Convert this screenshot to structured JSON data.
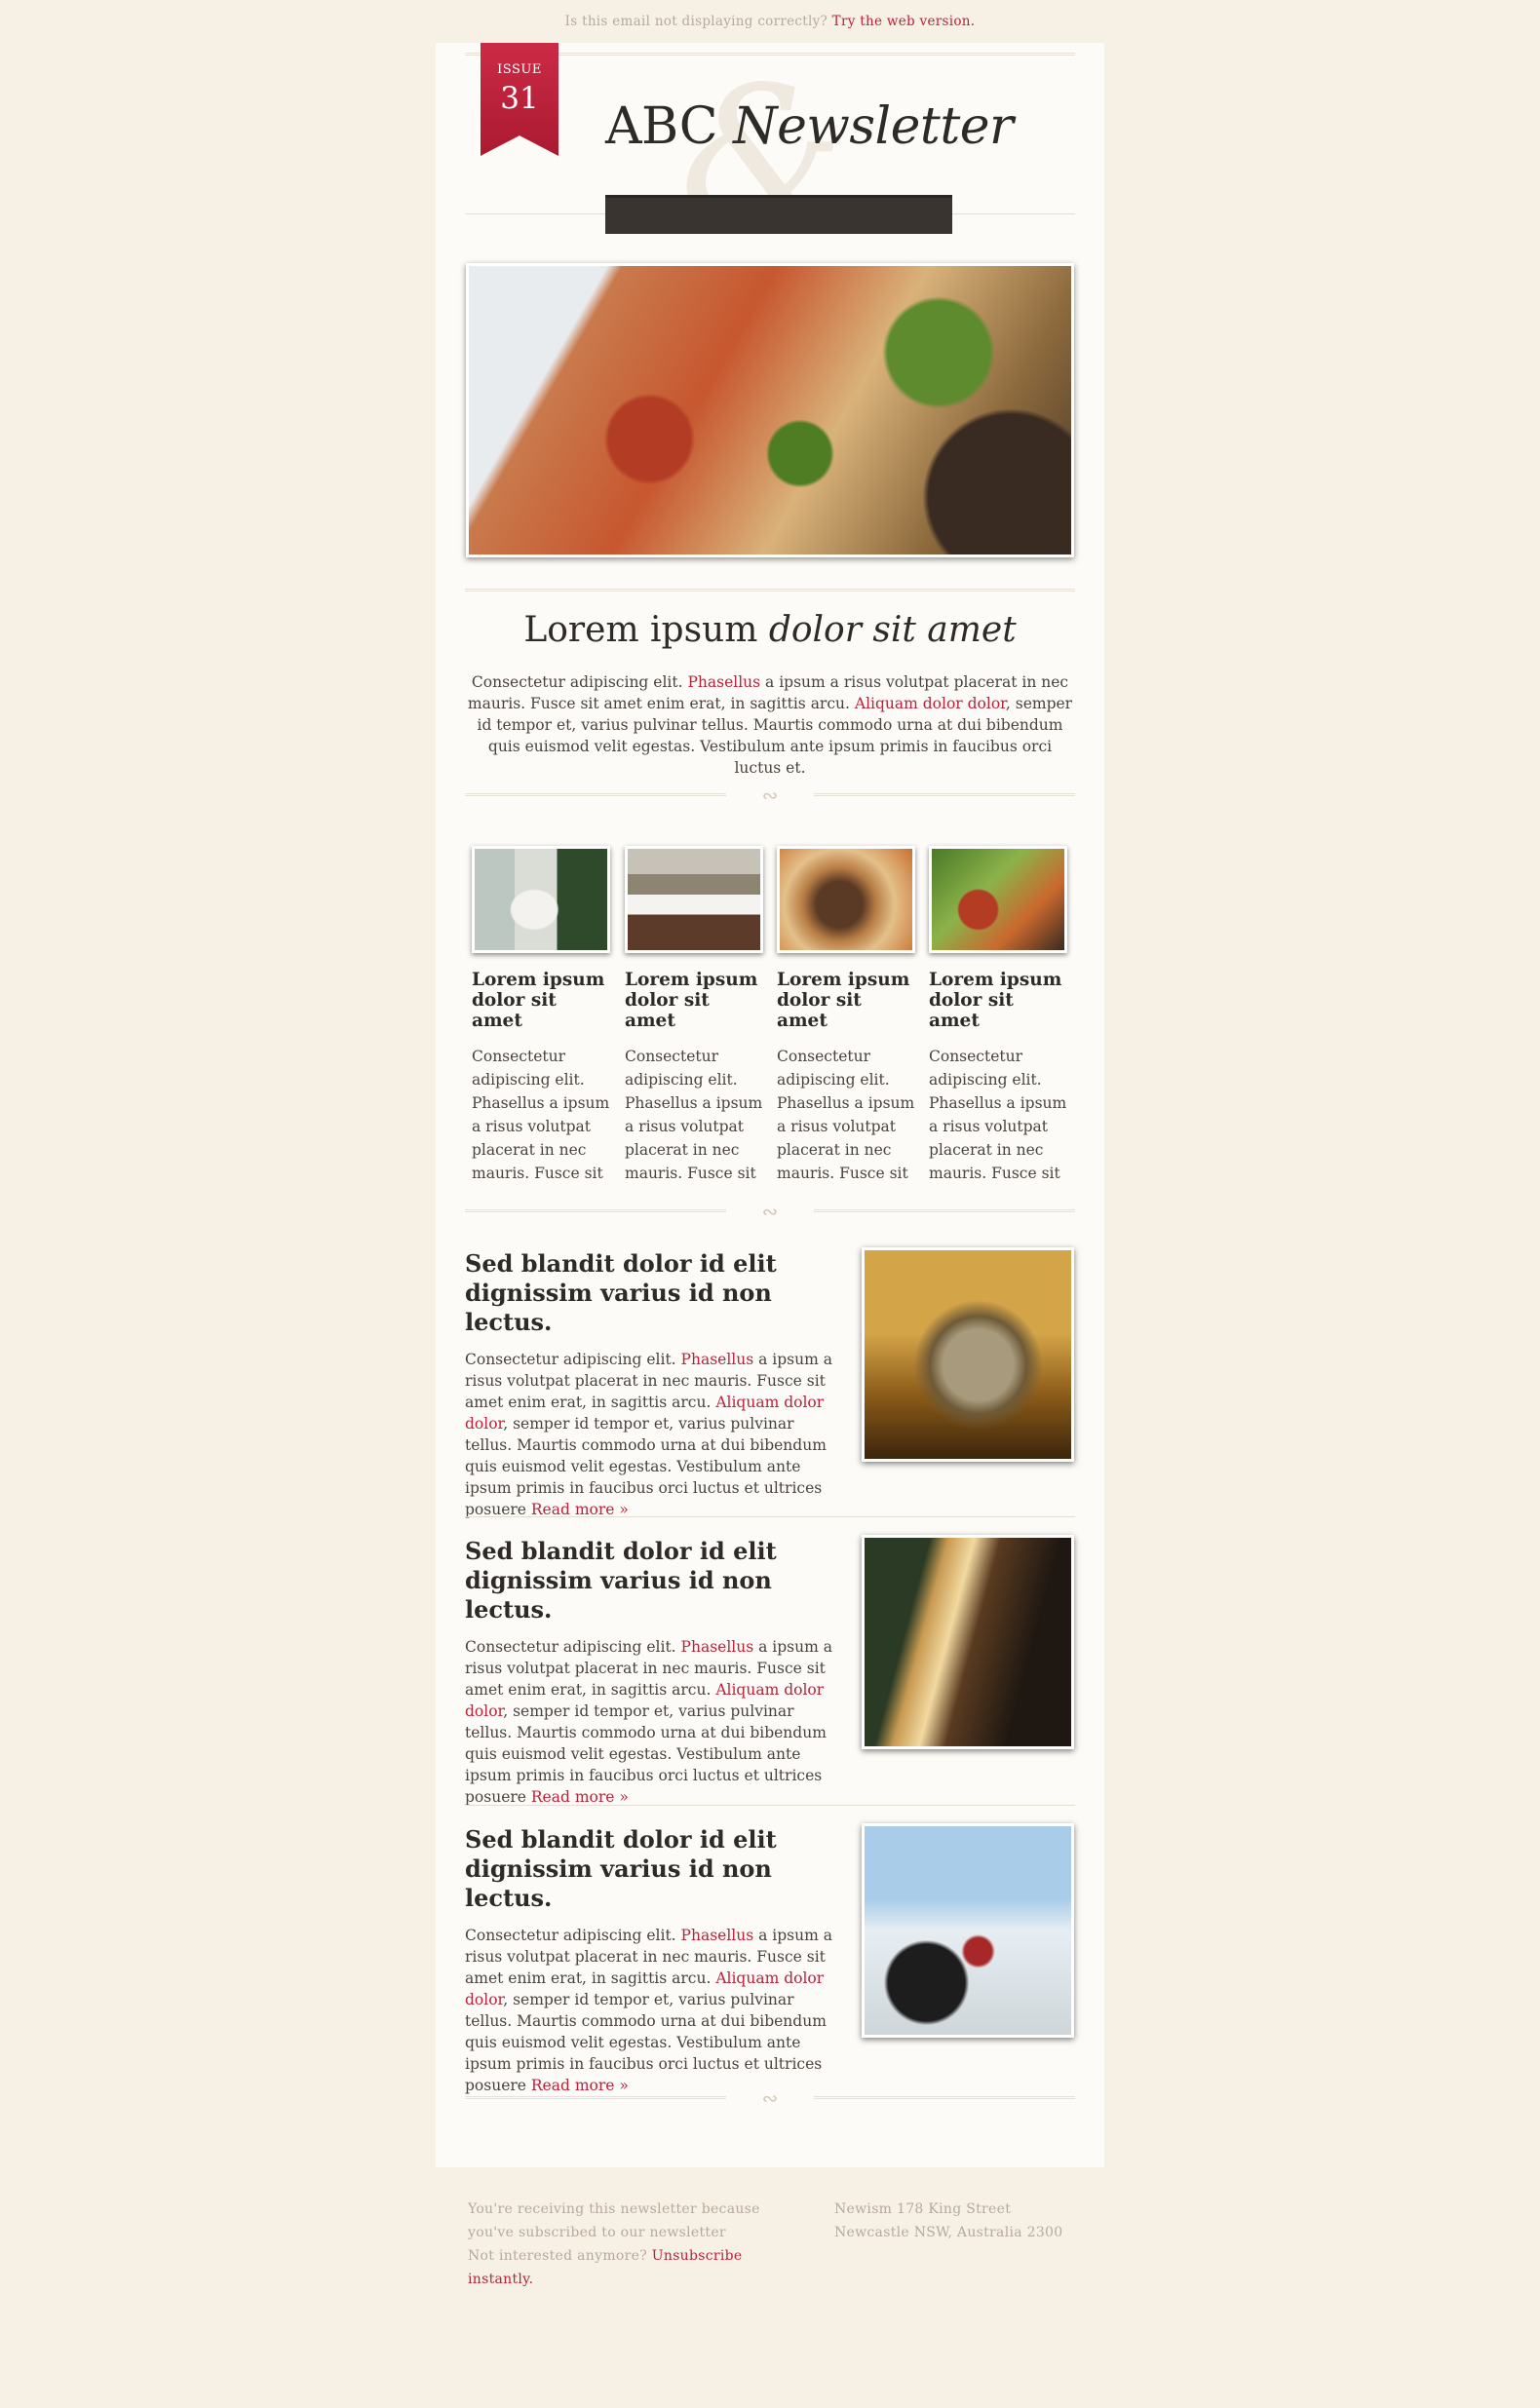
{
  "topbar": {
    "question": "Is this email not displaying correctly?",
    "link": "Try the web version."
  },
  "header": {
    "issue_label": "ISSUE",
    "issue_number": "31",
    "title_plain": "ABC",
    "title_italic": "Newsletter"
  },
  "hero": {
    "image": "pasta-dish-photo"
  },
  "intro": {
    "title_plain": "Lorem ipsum",
    "title_italic": "dolor sit amet",
    "text_1": "Consectetur adipiscing elit.",
    "link_1": "Phasellus",
    "text_2": "a ipsum a risus volutpat placerat in nec mauris. Fusce sit amet enim erat, in sagittis arcu.",
    "link_2": "Aliquam dolor dolor",
    "text_3": ", semper id tempor et, varius pulvinar tellus. Maurtis commodo urna at dui bibendum quis euismod velit egestas. Vestibulum ante ipsum primis in faucibus orci luctus et."
  },
  "columns": [
    {
      "image": "wedding-cake-photo",
      "title": "Lorem ipsum dolor sit amet",
      "text": "Consectetur adipiscing elit. Phasellus a ipsum a risus volutpat placerat in nec mauris. Fusce sit"
    },
    {
      "image": "restaurant-view-photo",
      "title": "Lorem ipsum dolor sit amet",
      "text": "Consectetur adipiscing elit. Phasellus a ipsum a risus volutpat placerat in nec mauris. Fusce sit"
    },
    {
      "image": "clams-dish-photo",
      "title": "Lorem ipsum dolor sit amet",
      "text": "Consectetur adipiscing elit. Phasellus a ipsum a risus volutpat placerat in nec mauris. Fusce sit"
    },
    {
      "image": "pasta-closeup-photo",
      "title": "Lorem ipsum dolor sit amet",
      "text": "Consectetur adipiscing elit. Phasellus a ipsum a risus volutpat placerat in nec mauris. Fusce sit"
    }
  ],
  "articles": [
    {
      "image": "ice-bucket-photo",
      "title": "Sed blandit dolor id elit dignissim varius id non lectus.",
      "text_1": "Consectetur adipiscing elit.",
      "link_1": "Phasellus",
      "text_2": "a ipsum a risus volutpat placerat in nec mauris. Fusce sit amet enim erat, in sagittis arcu.",
      "link_2": "Aliquam dolor dolor",
      "text_3": ", semper id tempor et, varius pulvinar tellus. Maurtis commodo urna at dui bibendum quis euismod velit egestas. Vestibulum ante ipsum primis in faucibus orci luctus et ultrices posuere",
      "read_more": "Read more »"
    },
    {
      "image": "harp-interior-photo",
      "title": "Sed blandit dolor id elit dignissim varius id non lectus.",
      "text_1": "Consectetur adipiscing elit.",
      "link_1": "Phasellus",
      "text_2": "a ipsum a risus volutpat placerat in nec mauris. Fusce sit amet enim erat, in sagittis arcu.",
      "link_2": "Aliquam dolor dolor",
      "text_3": ", semper id tempor et, varius pulvinar tellus. Maurtis commodo urna at dui bibendum quis euismod velit egestas. Vestibulum ante ipsum primis in faucibus orci luctus et ultrices posuere",
      "read_more": "Read more »"
    },
    {
      "image": "wine-glasses-photo",
      "title": "Sed blandit dolor id elit dignissim varius id non lectus.",
      "text_1": "Consectetur adipiscing elit.",
      "link_1": "Phasellus",
      "text_2": "a ipsum a risus volutpat placerat in nec mauris. Fusce sit amet enim erat, in sagittis arcu.",
      "link_2": "Aliquam dolor dolor",
      "text_3": ", semper id tempor et, varius pulvinar tellus. Maurtis commodo urna at dui bibendum quis euismod velit egestas. Vestibulum ante ipsum primis in faucibus orci luctus et ultrices posuere",
      "read_more": "Read more »"
    }
  ],
  "footer": {
    "line_1": "You're receiving this newsletter because",
    "line_2": "you've subscribed to our newsletter",
    "line_3": "Not interested anymore?",
    "unsubscribe": "Unsubscribe instantly.",
    "address_1": "Newism 178 King Street",
    "address_2": "Newcastle NSW, Australia 2300"
  },
  "colors": {
    "background": "#f7f0e4",
    "paper": "#fdfbf7",
    "accent_red": "#b8233a",
    "text_dark": "#2e2a27",
    "dark_bar": "#393430"
  }
}
